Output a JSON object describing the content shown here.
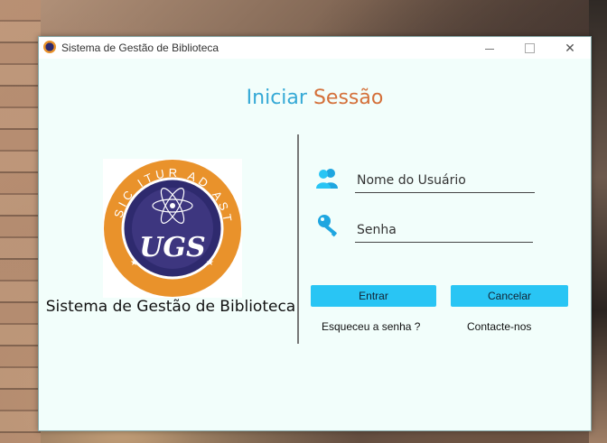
{
  "window": {
    "title": "Sistema de Gestão de Biblioteca"
  },
  "login": {
    "heading_part1": "Iniciar",
    "heading_part2": "Sessão",
    "username_placeholder": "Nome do Usuário",
    "password_placeholder": "Senha",
    "enter_label": "Entrar",
    "cancel_label": "Cancelar",
    "forgot_label": "Esqueceu a senha ?",
    "contact_label": "Contacte-nos"
  },
  "logo": {
    "motto": "SIC ITUR AD ASTRA",
    "monogram": "UGS"
  },
  "app_name": "Sistema de Gestão de Biblioteca",
  "colors": {
    "accent": "#29c5f4",
    "heading_blue": "#35a9d6",
    "heading_orange": "#d4703a",
    "window_bg": "#f2fefb",
    "logo_ring": "#e9922b",
    "logo_center": "#2e2a6e"
  },
  "icons": {
    "user": "users-icon",
    "password": "key-icon",
    "close": "close-icon"
  }
}
